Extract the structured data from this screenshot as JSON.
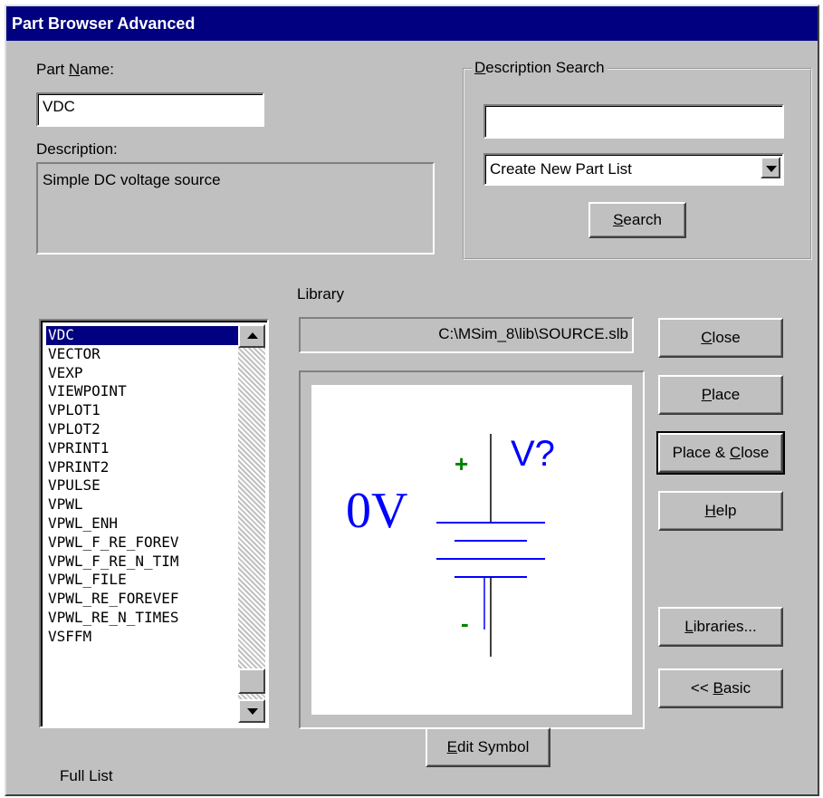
{
  "window": {
    "title": "Part Browser Advanced"
  },
  "part_name": {
    "label_prefix": "Part ",
    "label_accel": "N",
    "label_suffix": "ame:",
    "value": "VDC"
  },
  "description": {
    "label": "Description:",
    "value": "Simple DC voltage source"
  },
  "description_search": {
    "title_accel": "D",
    "title_rest": "escription Search",
    "input_value": "",
    "dropdown_value": "Create New Part List",
    "search_button_accel": "S",
    "search_button_rest": "earch"
  },
  "library": {
    "label": "Library",
    "path": "C:\\MSim_8\\lib\\SOURCE.slb"
  },
  "part_list": {
    "items": [
      "VDC",
      "VECTOR",
      "VEXP",
      "VIEWPOINT",
      "VPLOT1",
      "VPLOT2",
      "VPRINT1",
      "VPRINT2",
      "VPULSE",
      "VPWL",
      "VPWL_ENH",
      "VPWL_F_RE_FOREV",
      "VPWL_F_RE_N_TIM",
      "VPWL_FILE",
      "VPWL_RE_FOREVEF",
      "VPWL_RE_N_TIMES",
      "VSFFM"
    ],
    "selected_index": 0
  },
  "symbol_preview": {
    "value_text": "0V",
    "ref_text": "V?",
    "plus": "+",
    "minus": "-"
  },
  "buttons": {
    "close_accel": "C",
    "close_rest": "lose",
    "place_accel": "P",
    "place_rest": "lace",
    "place_close_prefix": "Place & ",
    "place_close_accel": "C",
    "place_close_rest": "lose",
    "help_accel": "H",
    "help_rest": "elp",
    "libraries_accel": "L",
    "libraries_rest": "ibraries...",
    "basic_prefix": "<< ",
    "basic_accel": "B",
    "basic_rest": "asic",
    "edit_symbol_accel": "E",
    "edit_symbol_rest": "dit Symbol"
  },
  "footer": {
    "full_list_label": "Full List"
  },
  "colors": {
    "titlebar": "#000080",
    "face": "#c0c0c0",
    "symbol_blue": "#0000ff",
    "symbol_green": "#008000"
  }
}
